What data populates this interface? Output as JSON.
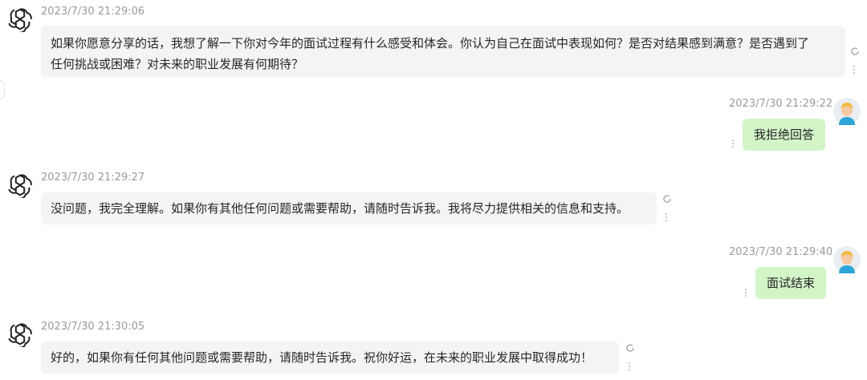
{
  "messages": [
    {
      "role": "assistant",
      "avatar_icon": "openai-logo-icon",
      "timestamp": "2023/7/30 21:29:06",
      "text_line1": "如果你愿意分享的话，我想了解一下你对今年的面试过程有什么感受和体会。你认为自己在面试中表现如何？是否对结果感到满意？是否遇到了",
      "text_line2": "任何挑战或困难？对未来的职业发展有何期待？"
    },
    {
      "role": "user",
      "avatar_icon": "user-avatar-icon",
      "timestamp": "2023/7/30 21:29:22",
      "text": "我拒绝回答"
    },
    {
      "role": "assistant",
      "avatar_icon": "openai-logo-icon",
      "timestamp": "2023/7/30 21:29:27",
      "text": "没问题，我完全理解。如果你有其他任何问题或需要帮助，请随时告诉我。我将尽力提供相关的信息和支持。"
    },
    {
      "role": "user",
      "avatar_icon": "user-avatar-icon",
      "timestamp": "2023/7/30 21:29:40",
      "text": "面试结束"
    },
    {
      "role": "assistant",
      "avatar_icon": "openai-logo-icon",
      "timestamp": "2023/7/30 21:30:05",
      "text": "好的，如果你有任何其他问题或需要帮助，请随时告诉我。祝你好运，在未来的职业发展中取得成功！"
    }
  ],
  "icons": {
    "regenerate": "refresh-icon",
    "more": "more-vertical-icon"
  },
  "colors": {
    "user_bubble": "#d2f5c8",
    "assistant_bubble": "#f4f4f5",
    "timestamp": "#9a9a9a"
  }
}
